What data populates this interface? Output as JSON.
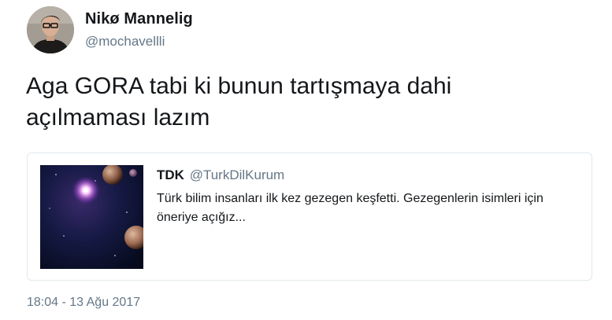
{
  "tweet": {
    "author": {
      "name": "Nikø Mannelig",
      "handle": "@mochavellli",
      "avatar_icon": "profile-avatar"
    },
    "text_line1": "Aga GORA tabi ki bunun tartışmaya dahi",
    "text_line2": "açılmaması lazım",
    "quoted": {
      "name": "TDK",
      "handle": "@TurkDilKurum",
      "text": "Türk bilim insanları ilk kez gezegen keşfetti. Gezegenlerin isimleri için öneriye açığız...",
      "image_icon": "space-planets-image"
    },
    "timestamp": "18:04 - 13 Ağu 2017"
  },
  "colors": {
    "text_primary": "#14171a",
    "text_secondary": "#657786",
    "card_border": "#e1e8ed"
  }
}
